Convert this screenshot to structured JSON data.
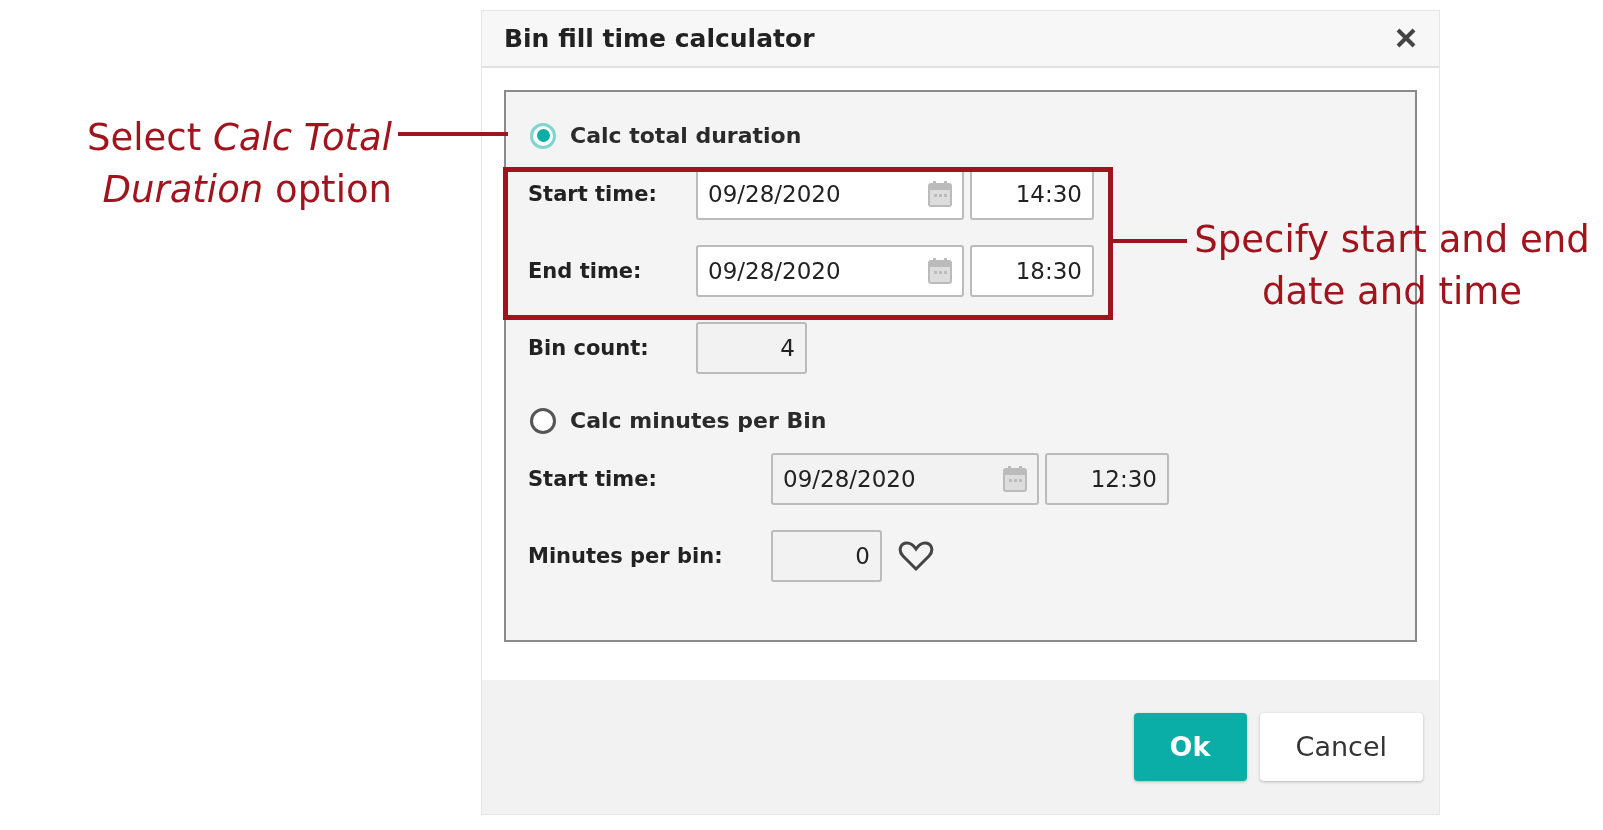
{
  "dialog": {
    "title": "Bin fill time calculator",
    "sections": [
      {
        "option": {
          "label": "Calc total duration",
          "selected": true
        },
        "fields": [
          {
            "kind": "datetime",
            "label": "Start time:",
            "date": "09/28/2020",
            "time": "14:30",
            "disabled": false
          },
          {
            "kind": "datetime",
            "label": "End time:",
            "date": "09/28/2020",
            "time": "18:30",
            "disabled": false
          },
          {
            "kind": "number",
            "label": "Bin count:",
            "value": "4",
            "disabled": true
          }
        ]
      },
      {
        "option": {
          "label": "Calc minutes per Bin",
          "selected": false
        },
        "fields": [
          {
            "kind": "datetime",
            "label": "Start time:",
            "date": "09/28/2020",
            "time": "12:30",
            "disabled": true
          },
          {
            "kind": "number_icon",
            "label": "Minutes per bin:",
            "value": "0",
            "disabled": true
          }
        ]
      }
    ],
    "buttons": [
      {
        "label": "Ok",
        "primary": true
      },
      {
        "label": "Cancel",
        "primary": false
      }
    ]
  },
  "annotations": {
    "left": "Select *Calc Total Duration* option",
    "right": "Specify start and end date and time"
  }
}
